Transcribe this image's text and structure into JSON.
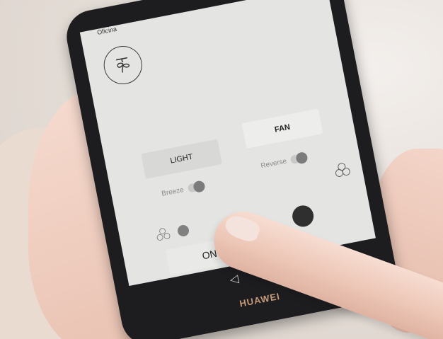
{
  "screen": {
    "room_name": "Oficina",
    "tabs": {
      "light": "LIGHT",
      "fan": "FAN"
    },
    "toggles": {
      "breeze": "Breeze",
      "reverse": "Reverse"
    },
    "power_button": "ON"
  },
  "device": {
    "brand": "HUAWEI"
  },
  "nav": {
    "back": "◁",
    "home": "○"
  }
}
